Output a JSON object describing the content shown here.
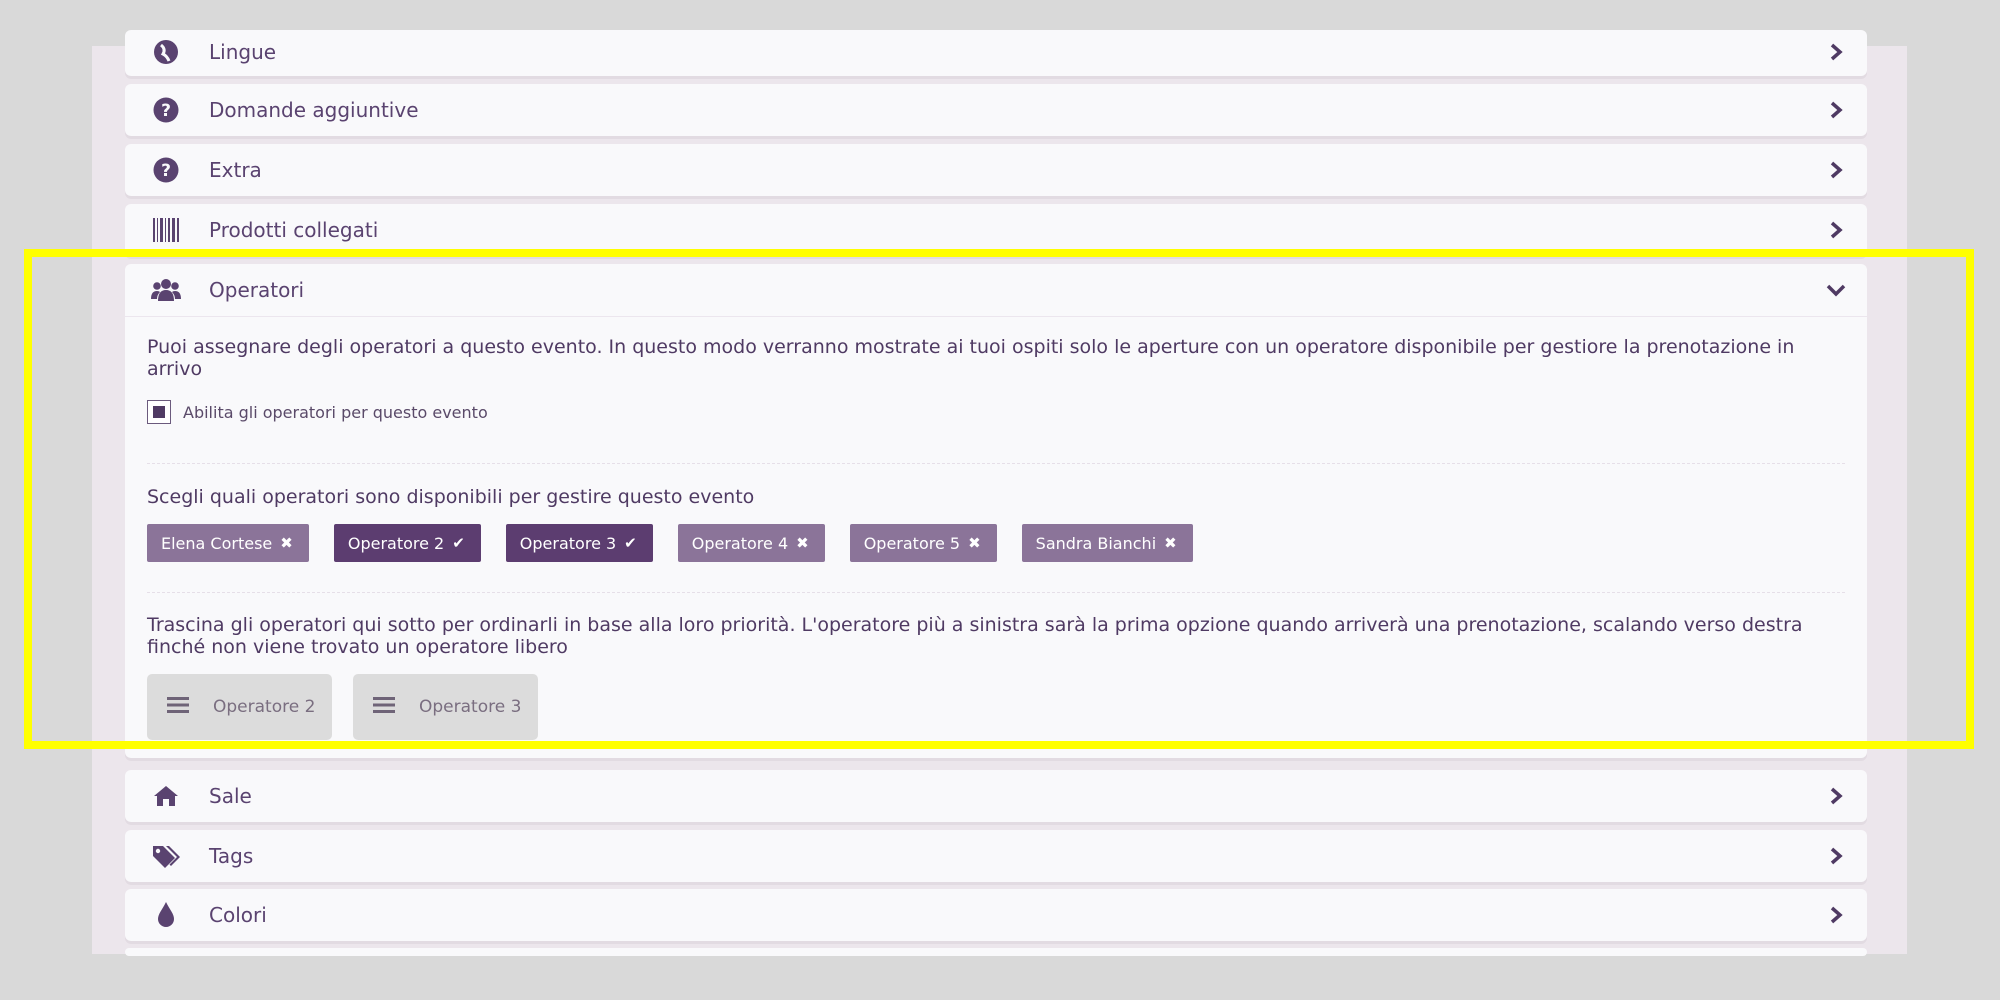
{
  "sections": {
    "lingue": {
      "label": "Lingue",
      "icon": "globe-icon"
    },
    "domande": {
      "label": "Domande aggiuntive",
      "icon": "question-circle-icon"
    },
    "extra": {
      "label": "Extra",
      "icon": "question-circle-icon"
    },
    "prodotti": {
      "label": "Prodotti collegati",
      "icon": "barcode-icon"
    },
    "operatori": {
      "label": "Operatori",
      "icon": "users-icon"
    },
    "sale": {
      "label": "Sale",
      "icon": "home-icon"
    },
    "tags": {
      "label": "Tags",
      "icon": "tags-icon"
    },
    "colori": {
      "label": "Colori",
      "icon": "droplet-icon"
    }
  },
  "operatori": {
    "description": "Puoi assegnare degli operatori a questo evento. In questo modo verranno mostrate ai tuoi ospiti solo le aperture con un operatore disponibile per gestiore la prenotazione in arrivo",
    "enable_label": "Abilita gli operatori per questo evento",
    "enabled": true,
    "choose_label": "Scegli quali operatori sono disponibili per gestire questo evento",
    "operators": [
      {
        "name": "Elena Cortese",
        "selected": false
      },
      {
        "name": "Operatore 2",
        "selected": true
      },
      {
        "name": "Operatore 3",
        "selected": true
      },
      {
        "name": "Operatore 4",
        "selected": false
      },
      {
        "name": "Operatore 5",
        "selected": false
      },
      {
        "name": "Sandra Bianchi",
        "selected": false
      }
    ],
    "order_label": "Trascina gli operatori qui sotto per ordinarli in base alla loro priorità. L'operatore più a sinistra sarà la prima opzione quando arriverà una prenotazione, scalando verso destra finché non viene trovato un operatore libero",
    "order": [
      "Operatore 2",
      "Operatore 3"
    ]
  },
  "colors": {
    "accent": "#5c3d70",
    "tag_unselected": "#8b7499",
    "highlight": "#ffff00"
  }
}
